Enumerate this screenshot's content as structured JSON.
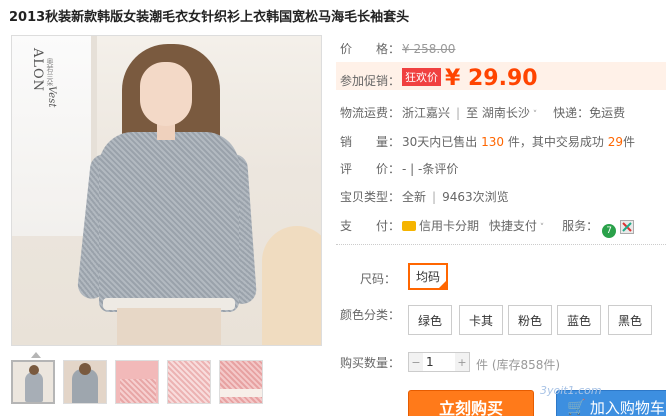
{
  "product": {
    "title": "2013秋装新款韩版女装潮毛衣女针织衫上衣韩国宽松马海毛长袖套头"
  },
  "gallery": {
    "brand_logo": "ALON",
    "brand_sub": "奥若兰朵",
    "brand_script": "Vest",
    "thumbnails": [
      "thumb-1",
      "thumb-2",
      "thumb-3",
      "thumb-4",
      "thumb-5"
    ]
  },
  "price": {
    "label": "价　　格：",
    "original": "¥ 258.00"
  },
  "promo": {
    "label": "参加促销：",
    "badge": "狂欢价",
    "price": "¥ 29.90"
  },
  "shipping": {
    "label": "物流运费：",
    "from": "浙江嘉兴",
    "to_prefix": "至",
    "to": "湖南长沙",
    "express": "快递：免运费"
  },
  "sales": {
    "label": "销　　量：",
    "prefix": "30天内已售出",
    "count": "130",
    "middle": "件，其中交易成功",
    "success": "29",
    "suffix": "件"
  },
  "reviews": {
    "label": "评　　价：",
    "text": "-  |  -条评价"
  },
  "item_type": {
    "label": "宝贝类型：",
    "condition": "全新",
    "views": "9463次浏览"
  },
  "payment": {
    "label": "支　　付：",
    "credit": "信用卡分期",
    "quick": "快捷支付",
    "service_label": "服务："
  },
  "size": {
    "label": "尺码：",
    "options": [
      "均码"
    ],
    "selected": "均码"
  },
  "color": {
    "label": "颜色分类：",
    "options": [
      "绿色",
      "卡其",
      "粉色",
      "蓝色",
      "黑色"
    ]
  },
  "quantity": {
    "label": "购买数量：",
    "value": "1",
    "unit": "件",
    "stock": "(库存858件)"
  },
  "actions": {
    "buy": "立刻购买",
    "cart": "加入购物车"
  },
  "watermark": "3yoit1.com",
  "colors": {
    "accent": "#ff6600",
    "price": "#ff4400",
    "buy": "#ff7a1a",
    "cart": "#3d8fe0"
  }
}
